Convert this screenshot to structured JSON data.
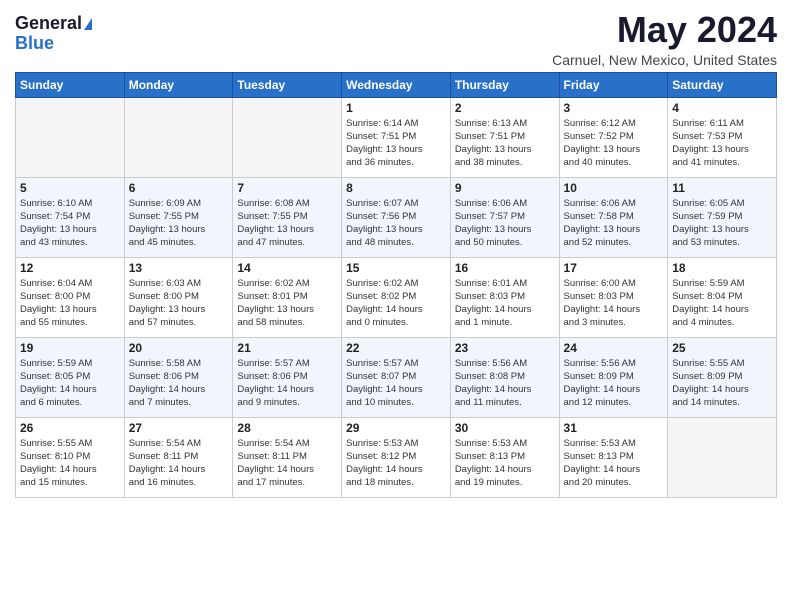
{
  "header": {
    "logo_general": "General",
    "logo_blue": "Blue",
    "month_title": "May 2024",
    "location": "Carnuel, New Mexico, United States"
  },
  "days_of_week": [
    "Sunday",
    "Monday",
    "Tuesday",
    "Wednesday",
    "Thursday",
    "Friday",
    "Saturday"
  ],
  "weeks": [
    [
      {
        "day": "",
        "info": ""
      },
      {
        "day": "",
        "info": ""
      },
      {
        "day": "",
        "info": ""
      },
      {
        "day": "1",
        "info": "Sunrise: 6:14 AM\nSunset: 7:51 PM\nDaylight: 13 hours\nand 36 minutes."
      },
      {
        "day": "2",
        "info": "Sunrise: 6:13 AM\nSunset: 7:51 PM\nDaylight: 13 hours\nand 38 minutes."
      },
      {
        "day": "3",
        "info": "Sunrise: 6:12 AM\nSunset: 7:52 PM\nDaylight: 13 hours\nand 40 minutes."
      },
      {
        "day": "4",
        "info": "Sunrise: 6:11 AM\nSunset: 7:53 PM\nDaylight: 13 hours\nand 41 minutes."
      }
    ],
    [
      {
        "day": "5",
        "info": "Sunrise: 6:10 AM\nSunset: 7:54 PM\nDaylight: 13 hours\nand 43 minutes."
      },
      {
        "day": "6",
        "info": "Sunrise: 6:09 AM\nSunset: 7:55 PM\nDaylight: 13 hours\nand 45 minutes."
      },
      {
        "day": "7",
        "info": "Sunrise: 6:08 AM\nSunset: 7:55 PM\nDaylight: 13 hours\nand 47 minutes."
      },
      {
        "day": "8",
        "info": "Sunrise: 6:07 AM\nSunset: 7:56 PM\nDaylight: 13 hours\nand 48 minutes."
      },
      {
        "day": "9",
        "info": "Sunrise: 6:06 AM\nSunset: 7:57 PM\nDaylight: 13 hours\nand 50 minutes."
      },
      {
        "day": "10",
        "info": "Sunrise: 6:06 AM\nSunset: 7:58 PM\nDaylight: 13 hours\nand 52 minutes."
      },
      {
        "day": "11",
        "info": "Sunrise: 6:05 AM\nSunset: 7:59 PM\nDaylight: 13 hours\nand 53 minutes."
      }
    ],
    [
      {
        "day": "12",
        "info": "Sunrise: 6:04 AM\nSunset: 8:00 PM\nDaylight: 13 hours\nand 55 minutes."
      },
      {
        "day": "13",
        "info": "Sunrise: 6:03 AM\nSunset: 8:00 PM\nDaylight: 13 hours\nand 57 minutes."
      },
      {
        "day": "14",
        "info": "Sunrise: 6:02 AM\nSunset: 8:01 PM\nDaylight: 13 hours\nand 58 minutes."
      },
      {
        "day": "15",
        "info": "Sunrise: 6:02 AM\nSunset: 8:02 PM\nDaylight: 14 hours\nand 0 minutes."
      },
      {
        "day": "16",
        "info": "Sunrise: 6:01 AM\nSunset: 8:03 PM\nDaylight: 14 hours\nand 1 minute."
      },
      {
        "day": "17",
        "info": "Sunrise: 6:00 AM\nSunset: 8:03 PM\nDaylight: 14 hours\nand 3 minutes."
      },
      {
        "day": "18",
        "info": "Sunrise: 5:59 AM\nSunset: 8:04 PM\nDaylight: 14 hours\nand 4 minutes."
      }
    ],
    [
      {
        "day": "19",
        "info": "Sunrise: 5:59 AM\nSunset: 8:05 PM\nDaylight: 14 hours\nand 6 minutes."
      },
      {
        "day": "20",
        "info": "Sunrise: 5:58 AM\nSunset: 8:06 PM\nDaylight: 14 hours\nand 7 minutes."
      },
      {
        "day": "21",
        "info": "Sunrise: 5:57 AM\nSunset: 8:06 PM\nDaylight: 14 hours\nand 9 minutes."
      },
      {
        "day": "22",
        "info": "Sunrise: 5:57 AM\nSunset: 8:07 PM\nDaylight: 14 hours\nand 10 minutes."
      },
      {
        "day": "23",
        "info": "Sunrise: 5:56 AM\nSunset: 8:08 PM\nDaylight: 14 hours\nand 11 minutes."
      },
      {
        "day": "24",
        "info": "Sunrise: 5:56 AM\nSunset: 8:09 PM\nDaylight: 14 hours\nand 12 minutes."
      },
      {
        "day": "25",
        "info": "Sunrise: 5:55 AM\nSunset: 8:09 PM\nDaylight: 14 hours\nand 14 minutes."
      }
    ],
    [
      {
        "day": "26",
        "info": "Sunrise: 5:55 AM\nSunset: 8:10 PM\nDaylight: 14 hours\nand 15 minutes."
      },
      {
        "day": "27",
        "info": "Sunrise: 5:54 AM\nSunset: 8:11 PM\nDaylight: 14 hours\nand 16 minutes."
      },
      {
        "day": "28",
        "info": "Sunrise: 5:54 AM\nSunset: 8:11 PM\nDaylight: 14 hours\nand 17 minutes."
      },
      {
        "day": "29",
        "info": "Sunrise: 5:53 AM\nSunset: 8:12 PM\nDaylight: 14 hours\nand 18 minutes."
      },
      {
        "day": "30",
        "info": "Sunrise: 5:53 AM\nSunset: 8:13 PM\nDaylight: 14 hours\nand 19 minutes."
      },
      {
        "day": "31",
        "info": "Sunrise: 5:53 AM\nSunset: 8:13 PM\nDaylight: 14 hours\nand 20 minutes."
      },
      {
        "day": "",
        "info": ""
      }
    ]
  ]
}
